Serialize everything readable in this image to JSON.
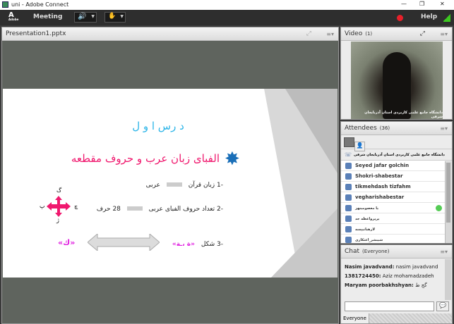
{
  "window": {
    "title": "uni - Adobe Connect",
    "min": "—",
    "max": "❐",
    "close": "✕"
  },
  "toolbar": {
    "logo": "Adobe",
    "meeting": "Meeting",
    "help": "Help"
  },
  "presentation": {
    "title": "Presentation1.pptx",
    "slide": {
      "heading": "د رس ا و ل",
      "title": "الفبای زبان عرب و حروف مقطعه",
      "item1": "-1 زبان قرآن",
      "item1_value": "عربی",
      "item2": "-2 تعداد حروف الفبای عربی",
      "item2_value": "28 حرف",
      "item3": "-3 شکل",
      "item3_value": "«ة ،ـة»",
      "item3_result": "«ك»",
      "arrow_top": "گ",
      "arrow_bottom": "ژ",
      "arrow_left": "پ",
      "arrow_right": "چ"
    }
  },
  "video": {
    "title": "Video",
    "count": "(1)",
    "caption": "دانشگاه جامع علمی کاربردی استان آذربایجان شرقی"
  },
  "attendees": {
    "title": "Attendees",
    "count": "(36)",
    "room": "دانشگاه جامع علمی کاربردی استان آذربایجان شرقی",
    "list": [
      "Seyed jafar golchin",
      "Shokri-shabestar",
      "tikmehdash tizfahm",
      "vegharishabestar",
      "یا معصومینهز",
      "پرپرواعظه جد",
      "لارهبانیپسه",
      "شیبشر_اعتکاری"
    ]
  },
  "chat": {
    "title": "Chat",
    "scope": "(Everyone)",
    "messages": [
      {
        "sender": "Nasim javadvand:",
        "text": "nasim javadvand"
      },
      {
        "sender": "1381724450:",
        "text": "Aziz mohamadzadeh"
      },
      {
        "sender": "Maryam  poorbakhshyan:",
        "text": "گج ط"
      }
    ],
    "input_placeholder": "",
    "tab": "Everyone"
  },
  "colors": {
    "accent_pink": "#f0186e",
    "heading_blue": "#2cb5e8",
    "star_blue": "#1a6fb8",
    "record_red": "#e8202a",
    "signal_green": "#3cc820"
  }
}
